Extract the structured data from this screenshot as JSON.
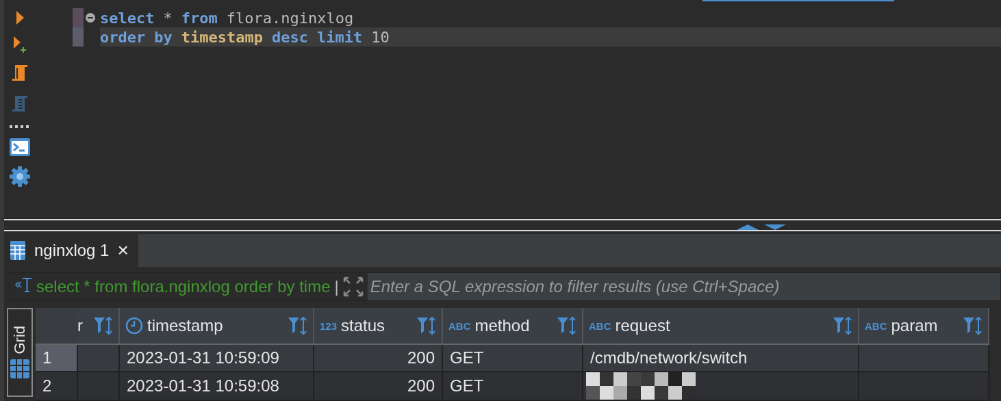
{
  "editor": {
    "gutter_tools": [
      {
        "kind": "run"
      },
      {
        "kind": "run-new"
      },
      {
        "kind": "script-run"
      },
      {
        "kind": "script"
      },
      {
        "kind": "more"
      },
      {
        "kind": "terminal"
      },
      {
        "kind": "settings"
      }
    ],
    "lines": [
      {
        "current": false,
        "tokens": [
          {
            "kind": "keyword",
            "text": "select"
          },
          {
            "kind": "plain",
            "text": "*"
          },
          {
            "kind": "keyword",
            "text": "from"
          },
          {
            "kind": "plain",
            "text": "flora.nginxlog"
          }
        ]
      },
      {
        "current": true,
        "tokens": [
          {
            "kind": "keyword",
            "text": "order"
          },
          {
            "kind": "keyword",
            "text": "by"
          },
          {
            "kind": "column",
            "text": "timestamp"
          },
          {
            "kind": "keyword",
            "text": "desc"
          },
          {
            "kind": "keyword",
            "text": "limit"
          },
          {
            "kind": "plain",
            "text": "10"
          }
        ]
      }
    ]
  },
  "results": {
    "tabs": [
      {
        "label": "nginxlog 1",
        "selected": true,
        "close": "×"
      }
    ],
    "filter": {
      "query": "select * from flora.nginxlog order by time",
      "separator": "|",
      "placeholder": "Enter a SQL expression to filter results (use Ctrl+Space)"
    },
    "side_tab": {
      "label": "Grid"
    },
    "columns": [
      {
        "label": "r",
        "kind": "cut"
      },
      {
        "label": "timestamp",
        "kind": "datetime"
      },
      {
        "label": "status",
        "kind": "number",
        "badge": "123"
      },
      {
        "label": "method",
        "kind": "text",
        "badge": "ABC"
      },
      {
        "label": "request",
        "kind": "text",
        "badge": "ABC"
      },
      {
        "label": "param",
        "kind": "text",
        "badge": "ABC"
      }
    ],
    "rows": [
      {
        "number": "1",
        "selected": true,
        "cells": [
          {
            "kind": "empty"
          },
          {
            "kind": "text",
            "text": "2023-01-31 10:59:09"
          },
          {
            "kind": "text",
            "text": "200"
          },
          {
            "kind": "text",
            "text": "GET"
          },
          {
            "kind": "text",
            "text": "/cmdb/network/switch"
          },
          {
            "kind": "empty"
          }
        ]
      },
      {
        "number": "2",
        "selected": false,
        "cells": [
          {
            "kind": "empty"
          },
          {
            "kind": "text",
            "text": "2023-01-31 10:59:08"
          },
          {
            "kind": "text",
            "text": "200"
          },
          {
            "kind": "text",
            "text": "GET"
          },
          {
            "kind": "pixelated"
          },
          {
            "kind": "empty"
          }
        ]
      }
    ]
  }
}
